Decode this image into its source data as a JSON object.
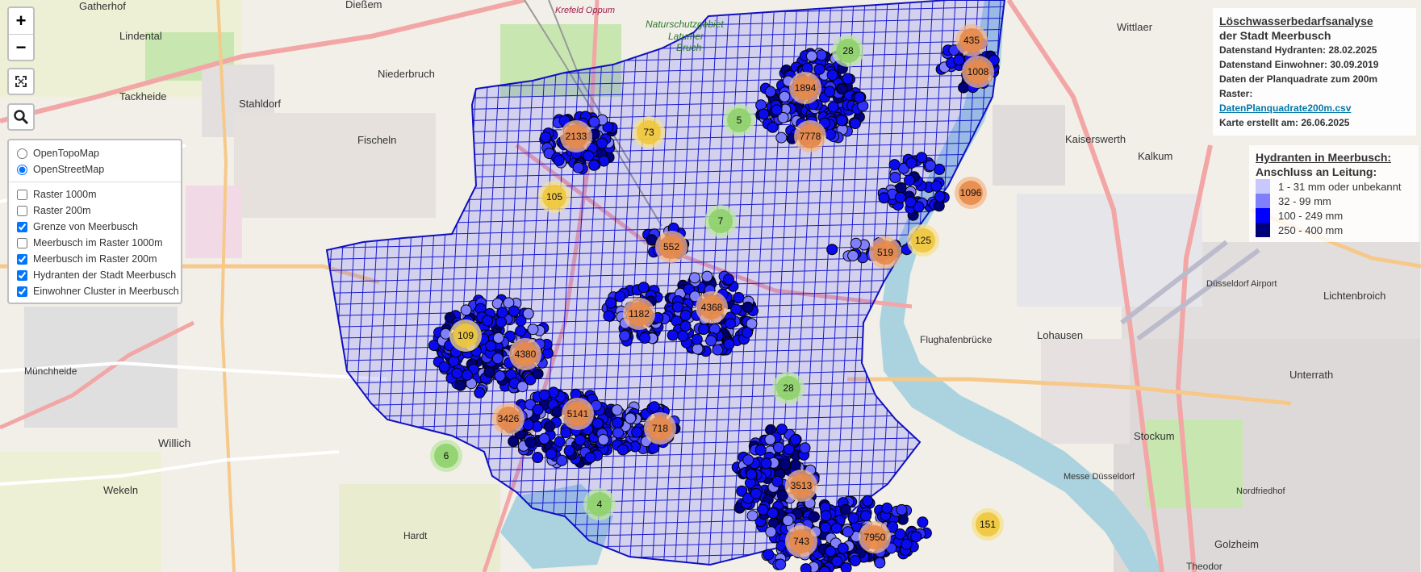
{
  "controls": {
    "zoom_in": "+",
    "zoom_out": "−"
  },
  "layers": {
    "base": [
      {
        "label": "OpenTopoMap",
        "checked": false
      },
      {
        "label": "OpenStreetMap",
        "checked": true
      }
    ],
    "overlays": [
      {
        "label": "Raster 1000m",
        "checked": false
      },
      {
        "label": "Raster 200m",
        "checked": false
      },
      {
        "label": "Grenze von Meerbusch",
        "checked": true
      },
      {
        "label": "Meerbusch im Raster 1000m",
        "checked": false
      },
      {
        "label": "Meerbusch im Raster 200m",
        "checked": true
      },
      {
        "label": "Hydranten der Stadt Meerbusch",
        "checked": true
      },
      {
        "label": "Einwohner Cluster in Meerbusch",
        "checked": true
      }
    ]
  },
  "info": {
    "title_line1": "Löschwasserbedarfsanalyse",
    "title_line2": "der Stadt Meerbusch",
    "line1": "Datenstand Hydranten: 28.02.2025",
    "line2": "Datenstand Einwohner: 30.09.2019",
    "line3": "Daten der Planquadrate zum 200m Raster:",
    "link": "DatenPlanquadrate200m.csv",
    "line4": "Karte erstellt am: 26.06.2025"
  },
  "legend": {
    "title1": "Hydranten in Meerbusch:",
    "title2": "Anschluss an Leitung:",
    "items": [
      {
        "label": "1 - 31 mm oder unbekannt",
        "color": "#c8c8ff"
      },
      {
        "label": "32 - 99 mm",
        "color": "#8080ff"
      },
      {
        "label": "100 - 249 mm",
        "color": "#0000ff"
      },
      {
        "label": "250 - 400 mm",
        "color": "#00007a"
      }
    ]
  },
  "places": [
    {
      "name": "Gatherhof"
    },
    {
      "name": "Dießem"
    },
    {
      "name": "Krefeld Oppum"
    },
    {
      "name": "Lindental"
    },
    {
      "name": "Niederbruch"
    },
    {
      "name": "Tackheide"
    },
    {
      "name": "Stahldorf"
    },
    {
      "name": "Fischeln"
    },
    {
      "name": "Naturschutzgebiet"
    },
    {
      "name": "Latumer"
    },
    {
      "name": "Bruch"
    },
    {
      "name": "Wittlaer"
    },
    {
      "name": "Kaiserswerth"
    },
    {
      "name": "Kalkum"
    },
    {
      "name": "Flughafenbrücke"
    },
    {
      "name": "Lohausen"
    },
    {
      "name": "Lichtenbroich"
    },
    {
      "name": "Unterrath"
    },
    {
      "name": "Stockum"
    },
    {
      "name": "Willich"
    },
    {
      "name": "Münchheide"
    },
    {
      "name": "Wekeln"
    },
    {
      "name": "Hardt"
    },
    {
      "name": "Golzheim"
    },
    {
      "name": "Theodor"
    },
    {
      "name": "Nordfriedhof"
    },
    {
      "name": "Messe Düsseldorf"
    },
    {
      "name": "Düsseldorf Airport"
    }
  ],
  "clusters": [
    {
      "label": "435",
      "tier": "orange"
    },
    {
      "label": "1008",
      "tier": "orange"
    },
    {
      "label": "28",
      "tier": "green"
    },
    {
      "label": "1894",
      "tier": "orange"
    },
    {
      "label": "7778",
      "tier": "orange"
    },
    {
      "label": "2133",
      "tier": "orange"
    },
    {
      "label": "73",
      "tier": "yellow"
    },
    {
      "label": "5",
      "tier": "green"
    },
    {
      "label": "105",
      "tier": "yellow"
    },
    {
      "label": "1096",
      "tier": "orange"
    },
    {
      "label": "7",
      "tier": "green"
    },
    {
      "label": "552",
      "tier": "orange"
    },
    {
      "label": "519",
      "tier": "orange"
    },
    {
      "label": "125",
      "tier": "yellow"
    },
    {
      "label": "1182",
      "tier": "orange"
    },
    {
      "label": "4368",
      "tier": "orange"
    },
    {
      "label": "109",
      "tier": "yellow"
    },
    {
      "label": "4380",
      "tier": "orange"
    },
    {
      "label": "28",
      "tier": "green"
    },
    {
      "label": "3426",
      "tier": "orange"
    },
    {
      "label": "5141",
      "tier": "orange"
    },
    {
      "label": "718",
      "tier": "orange"
    },
    {
      "label": "6",
      "tier": "green"
    },
    {
      "label": "3513",
      "tier": "orange"
    },
    {
      "label": "4",
      "tier": "green"
    },
    {
      "label": "7950",
      "tier": "orange"
    },
    {
      "label": "151",
      "tier": "yellow"
    },
    {
      "label": "743",
      "tier": "orange"
    }
  ],
  "colors": {
    "boundary": "#1010c0",
    "grid": "#1a1ad0",
    "hydrant": "#0a0aee",
    "cluster_orange": "#e88a4a",
    "cluster_yellow": "#f0c63c",
    "cluster_green": "#8fd16a",
    "river": "#aad3df",
    "road_major": "#f3a6a6"
  }
}
